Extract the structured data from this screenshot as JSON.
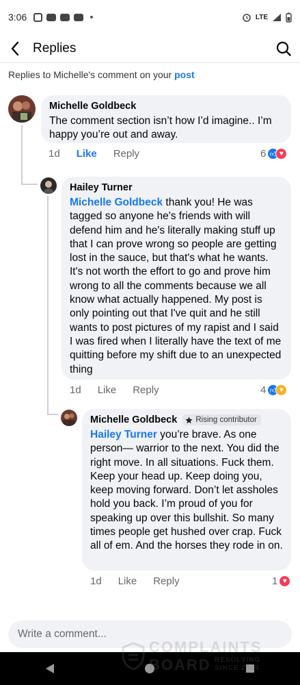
{
  "status_bar": {
    "time": "3:06",
    "network": "LTE"
  },
  "header": {
    "title": "Replies"
  },
  "context": {
    "prefix": "Replies to Michelle's comment on your ",
    "link": "post"
  },
  "comments": [
    {
      "author": "Michelle Goldbeck",
      "text": "The comment section isn’t how I’d imagine.. I’m happy you’re out and away.",
      "time": "1d",
      "like": "Like",
      "reply": "Reply",
      "reaction_count": "6",
      "reactions": [
        "like",
        "love"
      ]
    },
    {
      "author": "Hailey Turner",
      "mention": "Michelle Goldbeck",
      "text": " thank you! He was tagged so anyone he's friends with will defend him and he's literally making stuff up that I can prove wrong so people are getting lost in the sauce, but that's what he wants. It's not worth the effort to go and prove him wrong to all the comments because we all know what actually happened. My post is only pointing out that I've quit and he still wants to post pictures of my rapist and I said I was fired when I literally have the text of me quitting before my shift due to an unexpected thing",
      "time": "1d",
      "like": "Like",
      "reply": "Reply",
      "reaction_count": "4",
      "reactions": [
        "like",
        "care"
      ]
    },
    {
      "author": "Michelle Goldbeck",
      "badge": "Rising contributor",
      "mention": "Hailey Turner",
      "text": " you’re brave. As one person— warrior to the next. You did the right move. In all situations. Fuck them. Keep your head up. Keep doing you, keep moving forward. Don’t let assholes hold you back. I’m proud of you for speaking up over this bullshit. So many times people get hushed over crap. Fuck all of em. And the horses they rode in on.",
      "time": "1d",
      "like": "Like",
      "reply": "Reply",
      "reaction_count": "1",
      "reactions": [
        "love"
      ]
    }
  ],
  "composer": {
    "placeholder": "Write a comment..."
  },
  "watermark": {
    "line1": "COMPLAINTS",
    "line2": "BOARD",
    "tag1": "RESOLVING",
    "tag2": "SINCE 2004"
  },
  "colors": {
    "accent": "#1877f2",
    "bubble": "#f0f2f5",
    "love": "#f33e58",
    "care": "#f7b125"
  }
}
